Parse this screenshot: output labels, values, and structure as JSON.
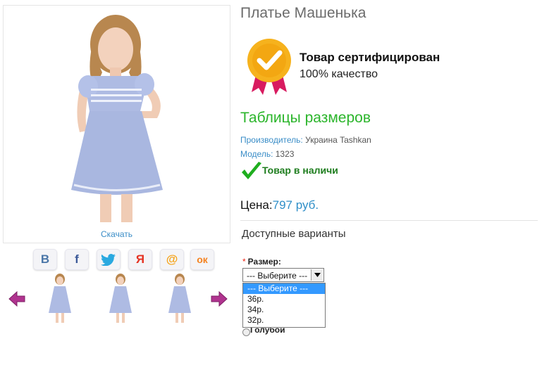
{
  "product": {
    "title": "Платье Машенька",
    "download_label": "Скачать",
    "certificate": {
      "title": "Товар сертифицирован",
      "subtitle": "100% качество"
    },
    "size_table_label": "Таблицы размеров",
    "manufacturer": {
      "key": "Производитель:",
      "value": "Украина Tashkan"
    },
    "model": {
      "key": "Модель:",
      "value": "1323"
    },
    "stock_text": "Товар в наличи",
    "price": {
      "label": "Цена:",
      "value": "797 руб."
    }
  },
  "share": [
    {
      "icon": "vk-icon",
      "glyph": "В",
      "color": "#4a76a8"
    },
    {
      "icon": "facebook-icon",
      "glyph": "f",
      "color": "#3b5998"
    },
    {
      "icon": "twitter-icon",
      "glyph": "🐦",
      "color": "#2aa9e0"
    },
    {
      "icon": "yaru-icon",
      "glyph": "Я",
      "color": "#e53222"
    },
    {
      "icon": "mailru-icon",
      "glyph": "@",
      "color": "#f5a31a"
    },
    {
      "icon": "odnoklassniki-icon",
      "glyph": "ок",
      "color": "#f58220"
    }
  ],
  "options": {
    "title": "Доступные варианты",
    "size": {
      "required_mark": "*",
      "label": "Размер:",
      "selected": "--- Выберите ---",
      "choices": [
        "--- Выберите ---",
        "36р.",
        "34р.",
        "32р."
      ]
    },
    "color_option": "Голубой"
  },
  "colors": {
    "accent_blue": "#2f8fc8",
    "green": "#2bb52b",
    "stock_green": "#1e7d1e",
    "dress": "#aebbe3",
    "arrow": "#b0338f"
  }
}
